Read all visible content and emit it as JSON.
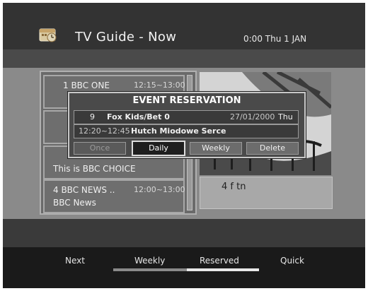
{
  "header": {
    "title": "TV Guide - Now",
    "clock": "0:00 Thu 1 JAN"
  },
  "channels": [
    {
      "name": "1 BBC ONE",
      "time": "12:15~13:00",
      "sub": ""
    },
    {
      "name": "",
      "time": "",
      "sub": ""
    },
    {
      "name": "",
      "time": "",
      "sub": "This is BBC CHOICE"
    },
    {
      "name": "4 BBC NEWS ..",
      "time": "12:00~13:00",
      "sub": "BBC News"
    }
  ],
  "info_box": {
    "text": "4 f tn"
  },
  "dialog": {
    "title": "EVENT RESERVATION",
    "channel_num": "9",
    "channel_name": "Fox Kids/Bet 0",
    "date": "27/01/2000",
    "day": "Thu",
    "time_range": "12:20~12:45",
    "program": "Hutch Miodowe Serce",
    "buttons": {
      "once": "Once",
      "daily": "Daily",
      "weekly": "Weekly",
      "delete": "Delete"
    }
  },
  "footer": {
    "next": "Next",
    "weekly": "Weekly",
    "reserved": "Reserved",
    "quick": "Quick"
  }
}
